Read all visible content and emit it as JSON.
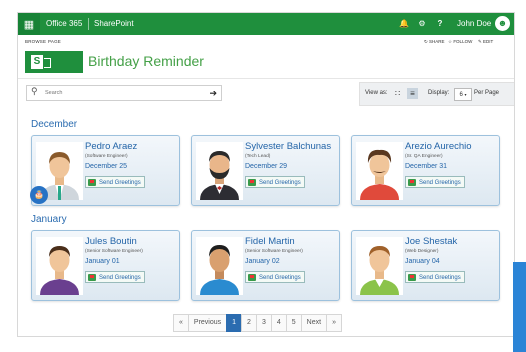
{
  "topbar": {
    "office": "Office 365",
    "sharepoint": "SharePoint",
    "bell_icon": "bell-icon",
    "gear_icon": "gear-icon",
    "help_icon": "help-icon",
    "user_name": "John Doe",
    "colors": {
      "suite_bar": "#1f8f3d"
    }
  },
  "ribbon": {
    "browse": "BROWSE",
    "page": "PAGE",
    "share": "SHARE",
    "follow": "FOLLOW",
    "edit": "EDIT"
  },
  "site": {
    "title": "Birthday Reminder"
  },
  "search": {
    "placeholder": "Search"
  },
  "controls": {
    "view_as": "View as:",
    "display": "Display:",
    "display_value": "6",
    "per_page": "Per Page"
  },
  "groups": [
    {
      "month": "December",
      "people": [
        {
          "name": "Pedro Araez",
          "role": "(Software Engineer)",
          "date": "December 25",
          "action": "Send Greetings"
        },
        {
          "name": "Sylvester Balchunas",
          "role": "(Tech Lead)",
          "date": "December 29",
          "action": "Send Greetings"
        },
        {
          "name": "Arezio Aurechio",
          "role": "(Sr. QA Engineer)",
          "date": "December 31",
          "action": "Send Greetings"
        }
      ]
    },
    {
      "month": "January",
      "people": [
        {
          "name": "Jules Boutin",
          "role": "(Senior Software Engineer)",
          "date": "January 01",
          "action": "Send Greetings"
        },
        {
          "name": "Fidel Martin",
          "role": "(Senior Software Engineer)",
          "date": "January 02",
          "action": "Send Greetings"
        },
        {
          "name": "Joe Shestak",
          "role": "(Web Designer)",
          "date": "January 04",
          "action": "Send Greetings"
        }
      ]
    }
  ],
  "pagination": {
    "first": "«",
    "previous": "Previous",
    "pages": [
      "1",
      "2",
      "3",
      "4",
      "5"
    ],
    "current": "1",
    "next": "Next",
    "last": "»"
  }
}
